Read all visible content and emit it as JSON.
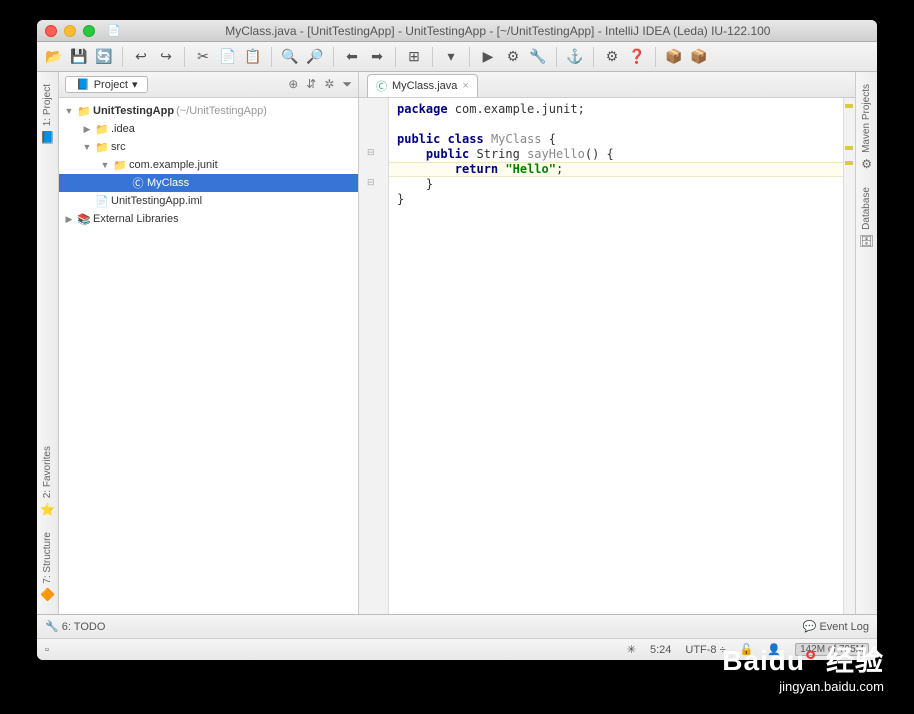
{
  "title": "MyClass.java - [UnitTestingApp] - UnitTestingApp - [~/UnitTestingApp] - IntelliJ IDEA (Leda) IU-122.100",
  "toolbar_icons": [
    "📂",
    "💾",
    "🔄",
    "↩",
    "↪",
    "✂",
    "📄",
    "📋",
    "🔍",
    "🔎",
    "⬅",
    "➡",
    "⊞",
    "▾",
    "▶",
    "⚙",
    "🔧",
    "⚓",
    "⚙",
    "❓",
    "📦",
    "📦"
  ],
  "left_rail": [
    {
      "icon": "📘",
      "label": "1: Project"
    }
  ],
  "left_rail_lower": [
    {
      "icon": "⭐",
      "label": "2: Favorites"
    },
    {
      "icon": "🔶",
      "label": "7: Structure"
    }
  ],
  "right_rail": [
    {
      "icon": "⚙",
      "label": "Maven Projects"
    },
    {
      "icon": "🗄",
      "label": "Database"
    }
  ],
  "project_panel": {
    "header_label": "Project",
    "header_icons": [
      "⊕",
      "⇵",
      "✲",
      "⏷"
    ],
    "tree": [
      {
        "indent": 0,
        "chev": "▼",
        "icon": "📁",
        "label": "UnitTestingApp",
        "suffix": " (~/UnitTestingApp)",
        "bold": true
      },
      {
        "indent": 1,
        "chev": "▶",
        "icon": "📁",
        "label": ".idea"
      },
      {
        "indent": 1,
        "chev": "▼",
        "icon": "📁",
        "label": "src"
      },
      {
        "indent": 2,
        "chev": "▼",
        "icon": "📁",
        "label": "com.example.junit"
      },
      {
        "indent": 3,
        "chev": "",
        "icon": "Ⓒ",
        "label": "MyClass",
        "sel": true
      },
      {
        "indent": 1,
        "chev": "",
        "icon": "📄",
        "label": "UnitTestingApp.iml"
      },
      {
        "indent": 0,
        "chev": "▶",
        "icon": "📚",
        "label": "External Libraries"
      }
    ]
  },
  "editor": {
    "tab_icon": "Ⓒ",
    "tab_label": "MyClass.java",
    "code_lines": [
      {
        "t": [
          {
            "c": "kw",
            "v": "package"
          },
          {
            "v": " com.example.junit;"
          }
        ]
      },
      {
        "t": []
      },
      {
        "t": [
          {
            "c": "kw",
            "v": "public class"
          },
          {
            "v": " "
          },
          {
            "c": "cls",
            "v": "MyClass"
          },
          {
            "v": " {"
          }
        ]
      },
      {
        "t": [
          {
            "v": "    "
          },
          {
            "c": "kw",
            "v": "public"
          },
          {
            "v": " String "
          },
          {
            "c": "cls",
            "v": "sayHello"
          },
          {
            "v": "() {"
          }
        ]
      },
      {
        "hl": true,
        "t": [
          {
            "v": "        "
          },
          {
            "c": "kw",
            "v": "return"
          },
          {
            "v": " "
          },
          {
            "c": "str",
            "v": "\"Hello\""
          },
          {
            "v": ";"
          }
        ]
      },
      {
        "t": [
          {
            "v": "    }"
          }
        ]
      },
      {
        "t": [
          {
            "v": "}"
          }
        ]
      }
    ]
  },
  "bottombar": {
    "todo": "6: TODO",
    "eventlog": "Event Log"
  },
  "status": {
    "pos": "5:24",
    "enc": "UTF-8",
    "lock": "🔓",
    "insp": "👤",
    "mem": "142M of 795M"
  },
  "watermark": {
    "brand": "Baidu",
    "brand_cn": "经验",
    "url": "jingyan.baidu.com"
  }
}
